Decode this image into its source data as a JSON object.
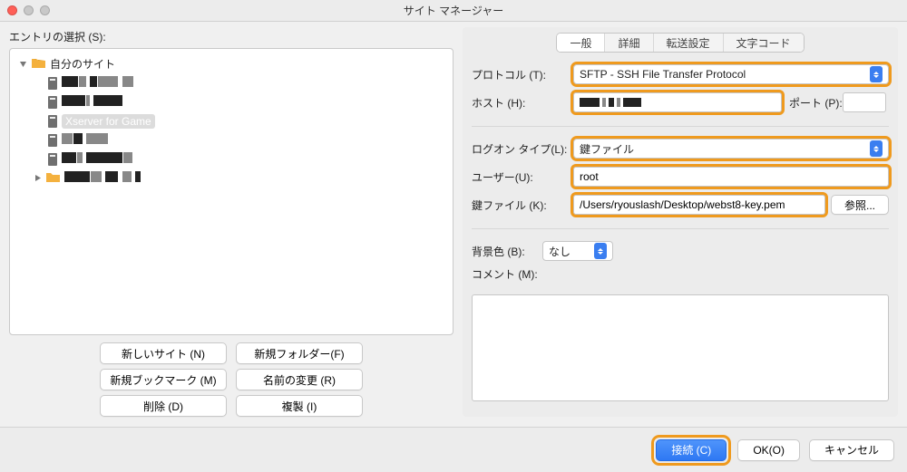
{
  "window": {
    "title": "サイト マネージャー"
  },
  "left": {
    "label": "エントリの選択 (S):",
    "tree": {
      "root": "自分のサイト",
      "selected": "Xserver for Game"
    },
    "buttons": {
      "new_site": "新しいサイト (N)",
      "new_folder": "新規フォルダー(F)",
      "new_bookmark": "新規ブックマーク (M)",
      "rename": "名前の変更 (R)",
      "delete": "削除 (D)",
      "duplicate": "複製 (I)"
    }
  },
  "tabs": {
    "general": "一般",
    "advanced": "詳細",
    "transfer": "転送設定",
    "charset": "文字コード"
  },
  "form": {
    "protocol_label": "プロトコル (T):",
    "protocol_value": "SFTP - SSH File Transfer Protocol",
    "host_label": "ホスト (H):",
    "host_value": "",
    "port_label": "ポート (P):",
    "port_value": "",
    "logon_label": "ログオン タイプ(L):",
    "logon_value": "鍵ファイル",
    "user_label": "ユーザー(U):",
    "user_value": "root",
    "keyfile_label": "鍵ファイル (K):",
    "keyfile_value": "/Users/ryouslash/Desktop/webst8-key.pem",
    "browse": "参照...",
    "bgcolor_label": "背景色 (B):",
    "bgcolor_value": "なし",
    "comment_label": "コメント (M):",
    "comment_value": ""
  },
  "footer": {
    "connect": "接続 (C)",
    "ok": "OK(O)",
    "cancel": "キャンセル"
  },
  "colors": {
    "highlight": "#ef9a1e",
    "primary": "#2e78f3"
  }
}
